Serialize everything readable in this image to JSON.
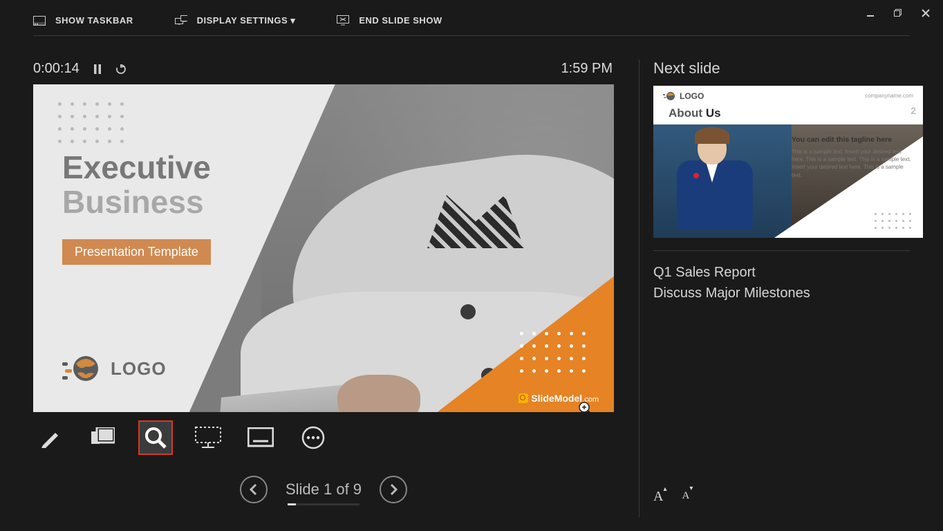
{
  "toolbar": {
    "show_taskbar": "SHOW TASKBAR",
    "display_settings": "DISPLAY SETTINGS ▾",
    "end_show": "END SLIDE SHOW"
  },
  "timer": {
    "elapsed": "0:00:14",
    "clock": "1:59 PM"
  },
  "slide": {
    "title_line1": "Executive",
    "title_line2": "Business",
    "subtitle": "Presentation Template",
    "logo_text": "LOGO",
    "slidemodel": "SlideModel",
    "slidemodel_suffix": ".com"
  },
  "nav": {
    "label": "Slide 1 of 9",
    "current": 1,
    "total": 9
  },
  "next": {
    "header": "Next slide",
    "logo_text": "LOGO",
    "company": "companyname.com",
    "slide_number": "2",
    "title_a": "About ",
    "title_b": "Us",
    "tagline": "You can edit this tagline here",
    "body": "This is a sample text. Insert your desired text here. This is a sample text. This is a sample text. Insert your desired text here. This is a sample text."
  },
  "notes": {
    "line1": "Q1 Sales Report",
    "line2": "Discuss Major Milestones"
  },
  "colors": {
    "accent": "#e58325",
    "active_border": "#d13a2b"
  }
}
